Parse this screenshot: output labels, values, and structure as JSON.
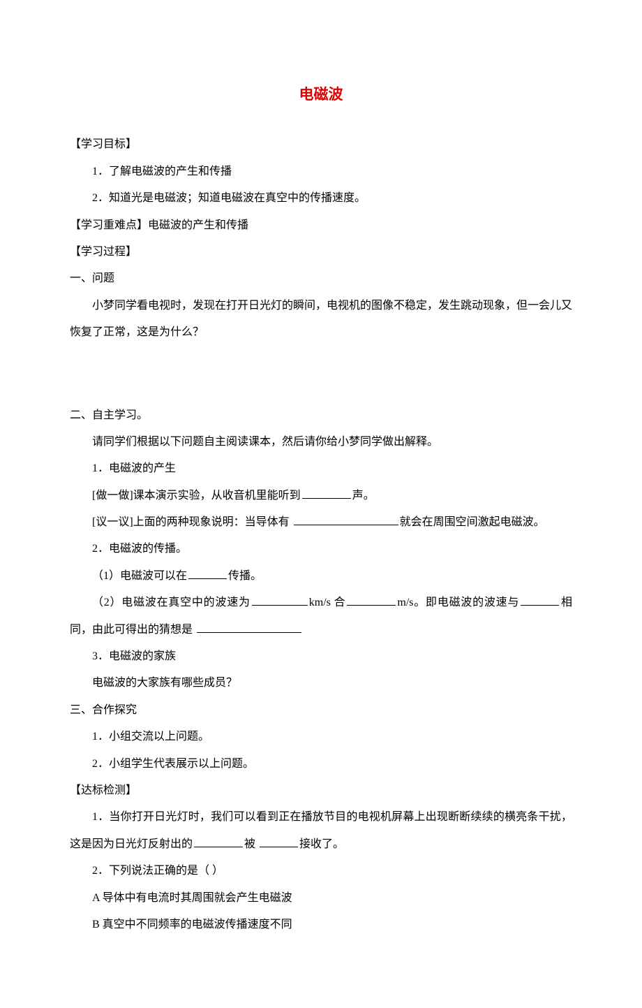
{
  "title": "电磁波",
  "headings": {
    "goals": "【学习目标】",
    "difficulty_label": "【学习重难点】",
    "difficulty_text": "电磁波的产生和传播",
    "process": "【学习过程】",
    "check": "【达标检测】"
  },
  "goals": {
    "g1": "1．了解电磁波的产生和传播",
    "g2": "2．知道光是电磁波；知道电磁波在真空中的传播速度。"
  },
  "process": {
    "s1_head": "一、问题",
    "s1_body": "小梦同学看电视时，发现在打开日光灯的瞬间，电视机的图像不稳定，发生跳动现象，但一会儿又恢复了正常，这是为什么？",
    "s2_head": "二、自主学习。",
    "s2_intro": "请同学们根据以下问题自主阅读课本，然后请你给小梦同学做出解释。",
    "p1_title": "1．电磁波的产生",
    "p1_do_pre": "[做一做]课本演示实验，从收音机里能听到",
    "p1_do_post": "声。",
    "p1_discuss_pre": "[议一议]上面的两种现象说明：当导体有 ",
    "p1_discuss_post": "就会在周围空间激起电磁波。",
    "p2_title": "2．电磁波的传播。",
    "p2_1_pre": "（1）电磁波可以在",
    "p2_1_post": "传播。",
    "p2_2_a": "（2）电磁波在真空中的波速为",
    "p2_2_b": "km/s 合",
    "p2_2_c": "m/s。即电磁波的波速与",
    "p2_2_d": "相同，由此可得出的猜想是 ",
    "p3_title": "3．电磁波的家族",
    "p3_body": "电磁波的大家族有哪些成员？",
    "s3_head": "三、合作探究",
    "s3_1": "1．小组交流以上问题。",
    "s3_2": "2．小组学生代表展示以上问题。"
  },
  "check": {
    "q1_a": "1．当你打开日光灯时，我们可以看到正在播放节目的电视机屏幕上出现断断续续的横亮条干扰，这是因为日光灯反射出的",
    "q1_b": "被 ",
    "q1_c": "接收了。",
    "q2": "2．下列说法正确的是（     ）",
    "q2_a": "A 导体中有电流时其周围就会产生电磁波",
    "q2_b": "B 真空中不同频率的电磁波传播速度不同"
  }
}
